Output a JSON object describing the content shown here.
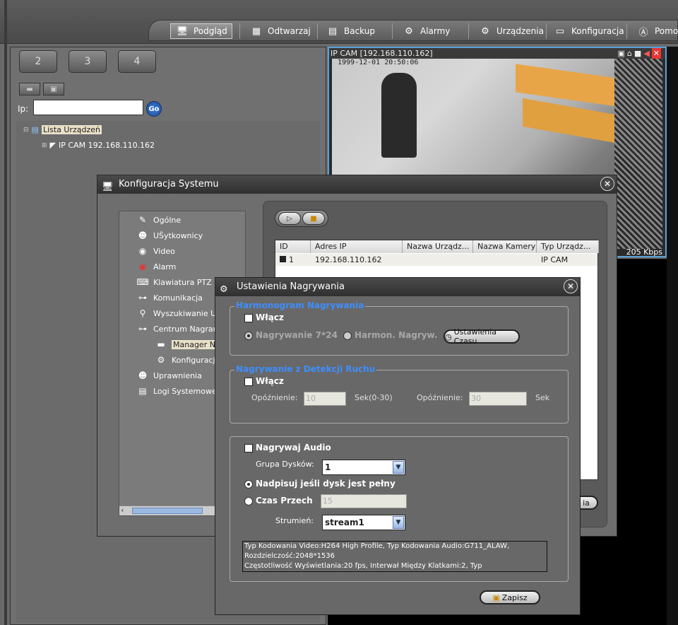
{
  "toolbar": {
    "tabs": [
      {
        "label": "Podgląd",
        "icon": "monitor-icon"
      },
      {
        "label": "Odtwarzaj",
        "icon": "film-icon"
      },
      {
        "label": "Backup",
        "icon": "backup-icon"
      },
      {
        "label": "Alarmy",
        "icon": "alarm-icon"
      },
      {
        "label": "Urządzenia",
        "icon": "device-icon"
      },
      {
        "label": "Konfiguracja",
        "icon": "config-icon"
      },
      {
        "label": "Pomoc",
        "icon": "help-icon"
      }
    ]
  },
  "left": {
    "screen_buttons": [
      "2",
      "3",
      "4"
    ],
    "ip_label": "Ip:",
    "ip_value": "",
    "go_label": "Go",
    "tree": {
      "root": "Lista Urządzeń",
      "child": "IP CAM 192.168.110.162"
    }
  },
  "video": {
    "title": "IP CAM [192.168.110.162]",
    "timestamp": "1999-12-01  20:50:06",
    "bitrate": "205 Kbps"
  },
  "cfg": {
    "title": "Konfiguracja Systemu",
    "tree": [
      "Ogólne",
      "UŜytkownicy",
      "Video",
      "Alarm",
      "Klawiatura PTZ",
      "Komunikacja",
      "Wyszukiwanie Urz",
      "Centrum Nagrań",
      "Manager Na",
      "Konfiguracja",
      "Uprawnienia",
      "Logi Systemowe"
    ],
    "table": {
      "headers": [
        "ID",
        "Adres IP",
        "Nazwa Urządz...",
        "Nazwa Kamery",
        "Typ Urządz..."
      ],
      "rows": [
        [
          "1",
          "192.168.110.162",
          "",
          "",
          "IP CAM"
        ]
      ]
    },
    "partial_button": "ia"
  },
  "rec": {
    "title": "Ustawienia Nagrywania",
    "schedule": {
      "legend": "Harmonogram Nagrywania",
      "enable": "Włącz",
      "opt1": "Nagrywanie 7*24",
      "opt2": "Harmon. Nagryw.",
      "time_btn": "Ustawienia Czasu"
    },
    "motion": {
      "legend": "Nagrywanie z Detekcji Ruchu",
      "enable": "Włącz",
      "pre_label": "Opóźnienie:",
      "pre_value": "10",
      "pre_unit": "Sek(0-30)",
      "post_label": "Opóźnienie:",
      "post_value": "30",
      "post_unit": "Sek"
    },
    "audio": {
      "record_audio": "Nagrywaj Audio",
      "disk_group_label": "Grupa Dysków:",
      "disk_group_value": "1",
      "overwrite": "Nadpisuj jeśli dysk jest pełny",
      "keep_time": "Czas Przech",
      "keep_value": "15",
      "stream_label": "Strumień:",
      "stream_value": "stream1",
      "info1": "Typ Kodowania Video:H264 High Profile, Typ Kodowania Audio:G711_ALAW, Rozdzielczość:2048*1536",
      "info2": " Częstotliwość Wyświetlania:20 fps, Interwał Między Klatkami:2, Typ"
    },
    "save": "Zapisz"
  }
}
